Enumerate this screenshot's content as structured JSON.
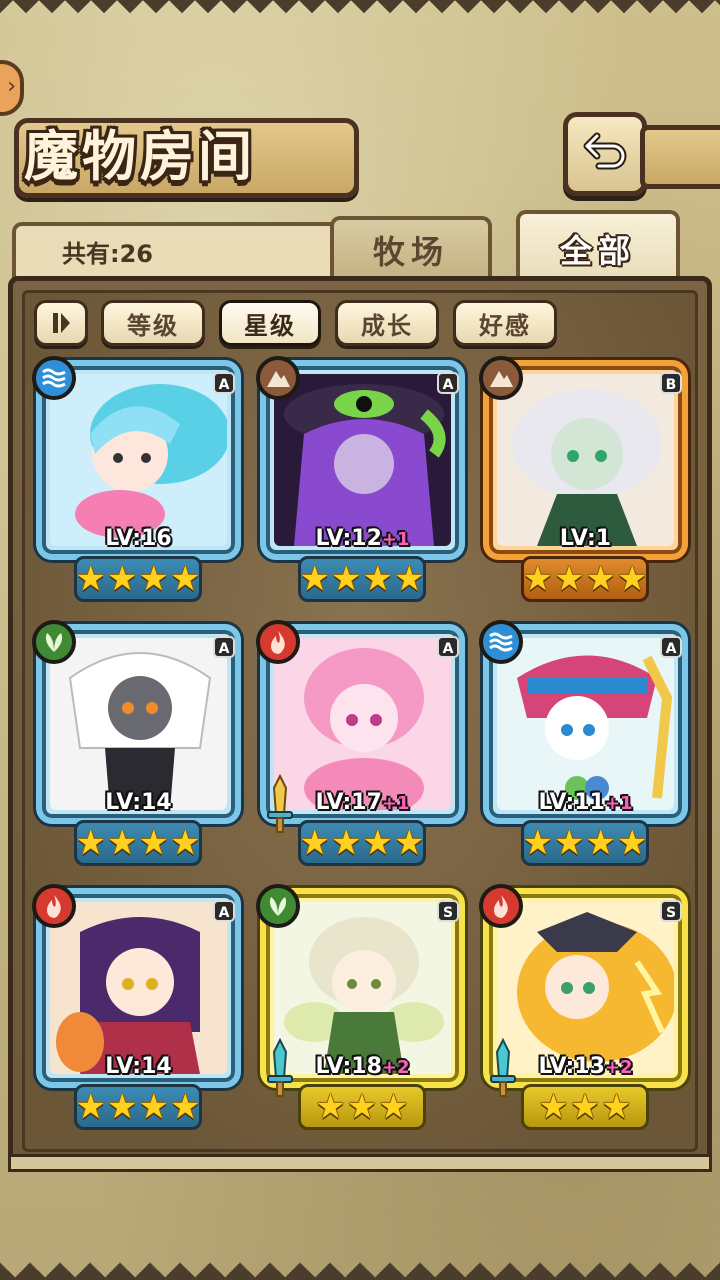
{
  "header": {
    "title": "魔物房间",
    "back_icon": "back-arrow-icon"
  },
  "count_label": "共有:26",
  "tabs": [
    {
      "label": "牧场",
      "active": false
    },
    {
      "label": "全部",
      "active": true
    }
  ],
  "filters": {
    "toggle_icon": "sort-toggle-icon",
    "items": [
      {
        "label": "等级",
        "active": false
      },
      {
        "label": "星级",
        "active": true
      },
      {
        "label": "成长",
        "active": false
      },
      {
        "label": "好感",
        "active": false
      }
    ]
  },
  "monsters": [
    {
      "element": "water",
      "rank": "A",
      "level": "LV:16",
      "plus": "",
      "stars": 4
    },
    {
      "element": "earth",
      "rank": "A",
      "level": "LV:12",
      "plus": "+1",
      "stars": 4
    },
    {
      "element": "earth",
      "rank": "B",
      "level": "LV:1",
      "plus": "",
      "stars": 4
    },
    {
      "element": "grass",
      "rank": "A",
      "level": "LV:14",
      "plus": "",
      "stars": 4
    },
    {
      "element": "fire",
      "rank": "A",
      "level": "LV:17",
      "plus": "+1",
      "stars": 4,
      "equipped_weapon": true
    },
    {
      "element": "water",
      "rank": "A",
      "level": "LV:11",
      "plus": "+1",
      "stars": 4
    },
    {
      "element": "fire",
      "rank": "A",
      "level": "LV:14",
      "plus": "",
      "stars": 4
    },
    {
      "element": "grass",
      "rank": "S",
      "level": "LV:18",
      "plus": "+2",
      "stars": 3,
      "equipped_weapon": true
    },
    {
      "element": "fire",
      "rank": "S",
      "level": "LV:13",
      "plus": "+2",
      "stars": 3,
      "equipped_weapon": true
    }
  ],
  "colors": {
    "rank_a_frame": "#7cc7e8",
    "rank_b_frame": "#f3a23a",
    "rank_s_frame": "#f7e24a",
    "star": "#ffd21f",
    "level_plus": "#ff5fb8"
  }
}
